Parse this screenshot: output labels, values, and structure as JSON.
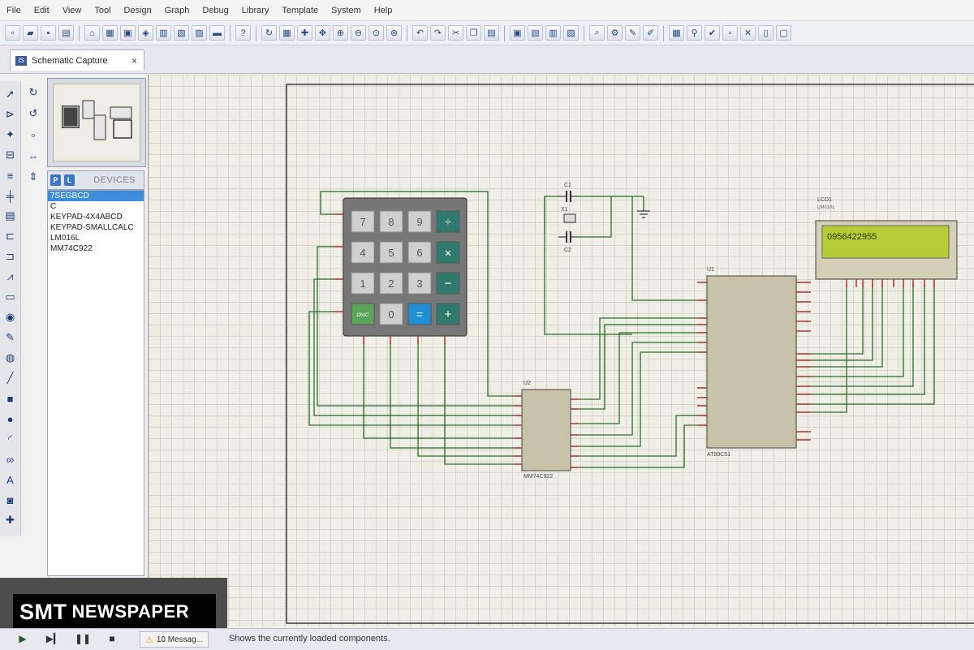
{
  "menu": [
    "File",
    "Edit",
    "View",
    "Tool",
    "Design",
    "Graph",
    "Debug",
    "Library",
    "Template",
    "System",
    "Help"
  ],
  "tab": {
    "label": "Schematic Capture",
    "icon": "isis-icon",
    "close": "×"
  },
  "devices": {
    "header": "DEVICES",
    "p_label": "P",
    "l_label": "L",
    "items": [
      "7SEGBCD",
      "C",
      "KEYPAD-4X4ABCD",
      "KEYPAD-SMALLCALC",
      "LM016L",
      "MM74C922"
    ],
    "selected_index": 0
  },
  "schematic": {
    "keypad_keys": [
      "7",
      "8",
      "9",
      "÷",
      "4",
      "5",
      "6",
      "×",
      "1",
      "2",
      "3",
      "−",
      "ON/C",
      "0",
      "=",
      "+"
    ],
    "lcd_label": "LCD1",
    "lcd_model": "LM016L",
    "lcd_text": "0956422955",
    "cap_label": "C1",
    "crystal_label": "X1",
    "cap2_label": "C2",
    "mcu_label": "U1",
    "mcu_model": "AT89C51",
    "encoder_label": "U2",
    "encoder_model": "MM74C922"
  },
  "watermark": {
    "bold": "SMT",
    "rest": "NEWSPAPER"
  },
  "status": {
    "messages": "10 Messag...",
    "text": "Shows the currently loaded components."
  },
  "colors": {
    "canvas": "#efefe5",
    "grid": "#d6d6c8",
    "wire": "#2d6b2d",
    "component": "#c6c3a8",
    "pin": "#b03030",
    "lcd": "#b6cc36"
  }
}
